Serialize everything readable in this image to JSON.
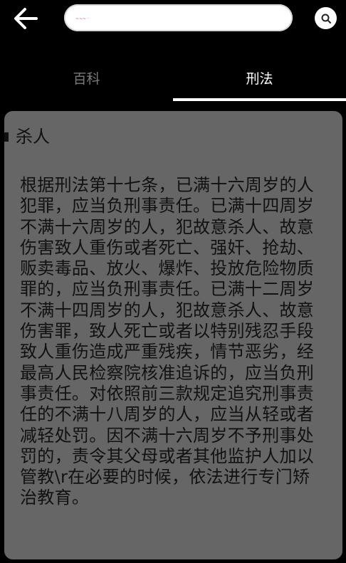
{
  "header": {
    "search_value": "~~~ ·",
    "search_placeholder": ""
  },
  "tabs": [
    {
      "label": "百科"
    },
    {
      "label": "刑法"
    }
  ],
  "article": {
    "title": "杀人",
    "body": "根据刑法第十七条，已满十六周岁的人犯罪，应当负刑事责任。已满十四周岁不满十六周岁的人，犯故意杀人、故意伤害致人重伤或者死亡、强奸、抢劫、贩卖毒品、放火、爆炸、投放危险物质罪的，应当负刑事责任。已满十二周岁不满十四周岁的人，犯故意杀人、故意伤害罪，致人死亡或者以特别残忍手段致人重伤造成严重残疾，情节恶劣，经最高人民检察院核准追诉的，应当负刑事责任。对依照前三款规定追究刑事责任的不满十八周岁的人，应当从轻或者减轻处罚。因不满十六周岁不予刑事处罚的，责令其父母或者其他监护人加以管教\\r在必要的时候，依法进行专门矫治教育。"
  },
  "colors": {
    "background": "#000000",
    "card": "#666666",
    "text_dark": "#111111",
    "tab_inactive": "#7a7a7a",
    "tab_active": "#ffffff"
  }
}
